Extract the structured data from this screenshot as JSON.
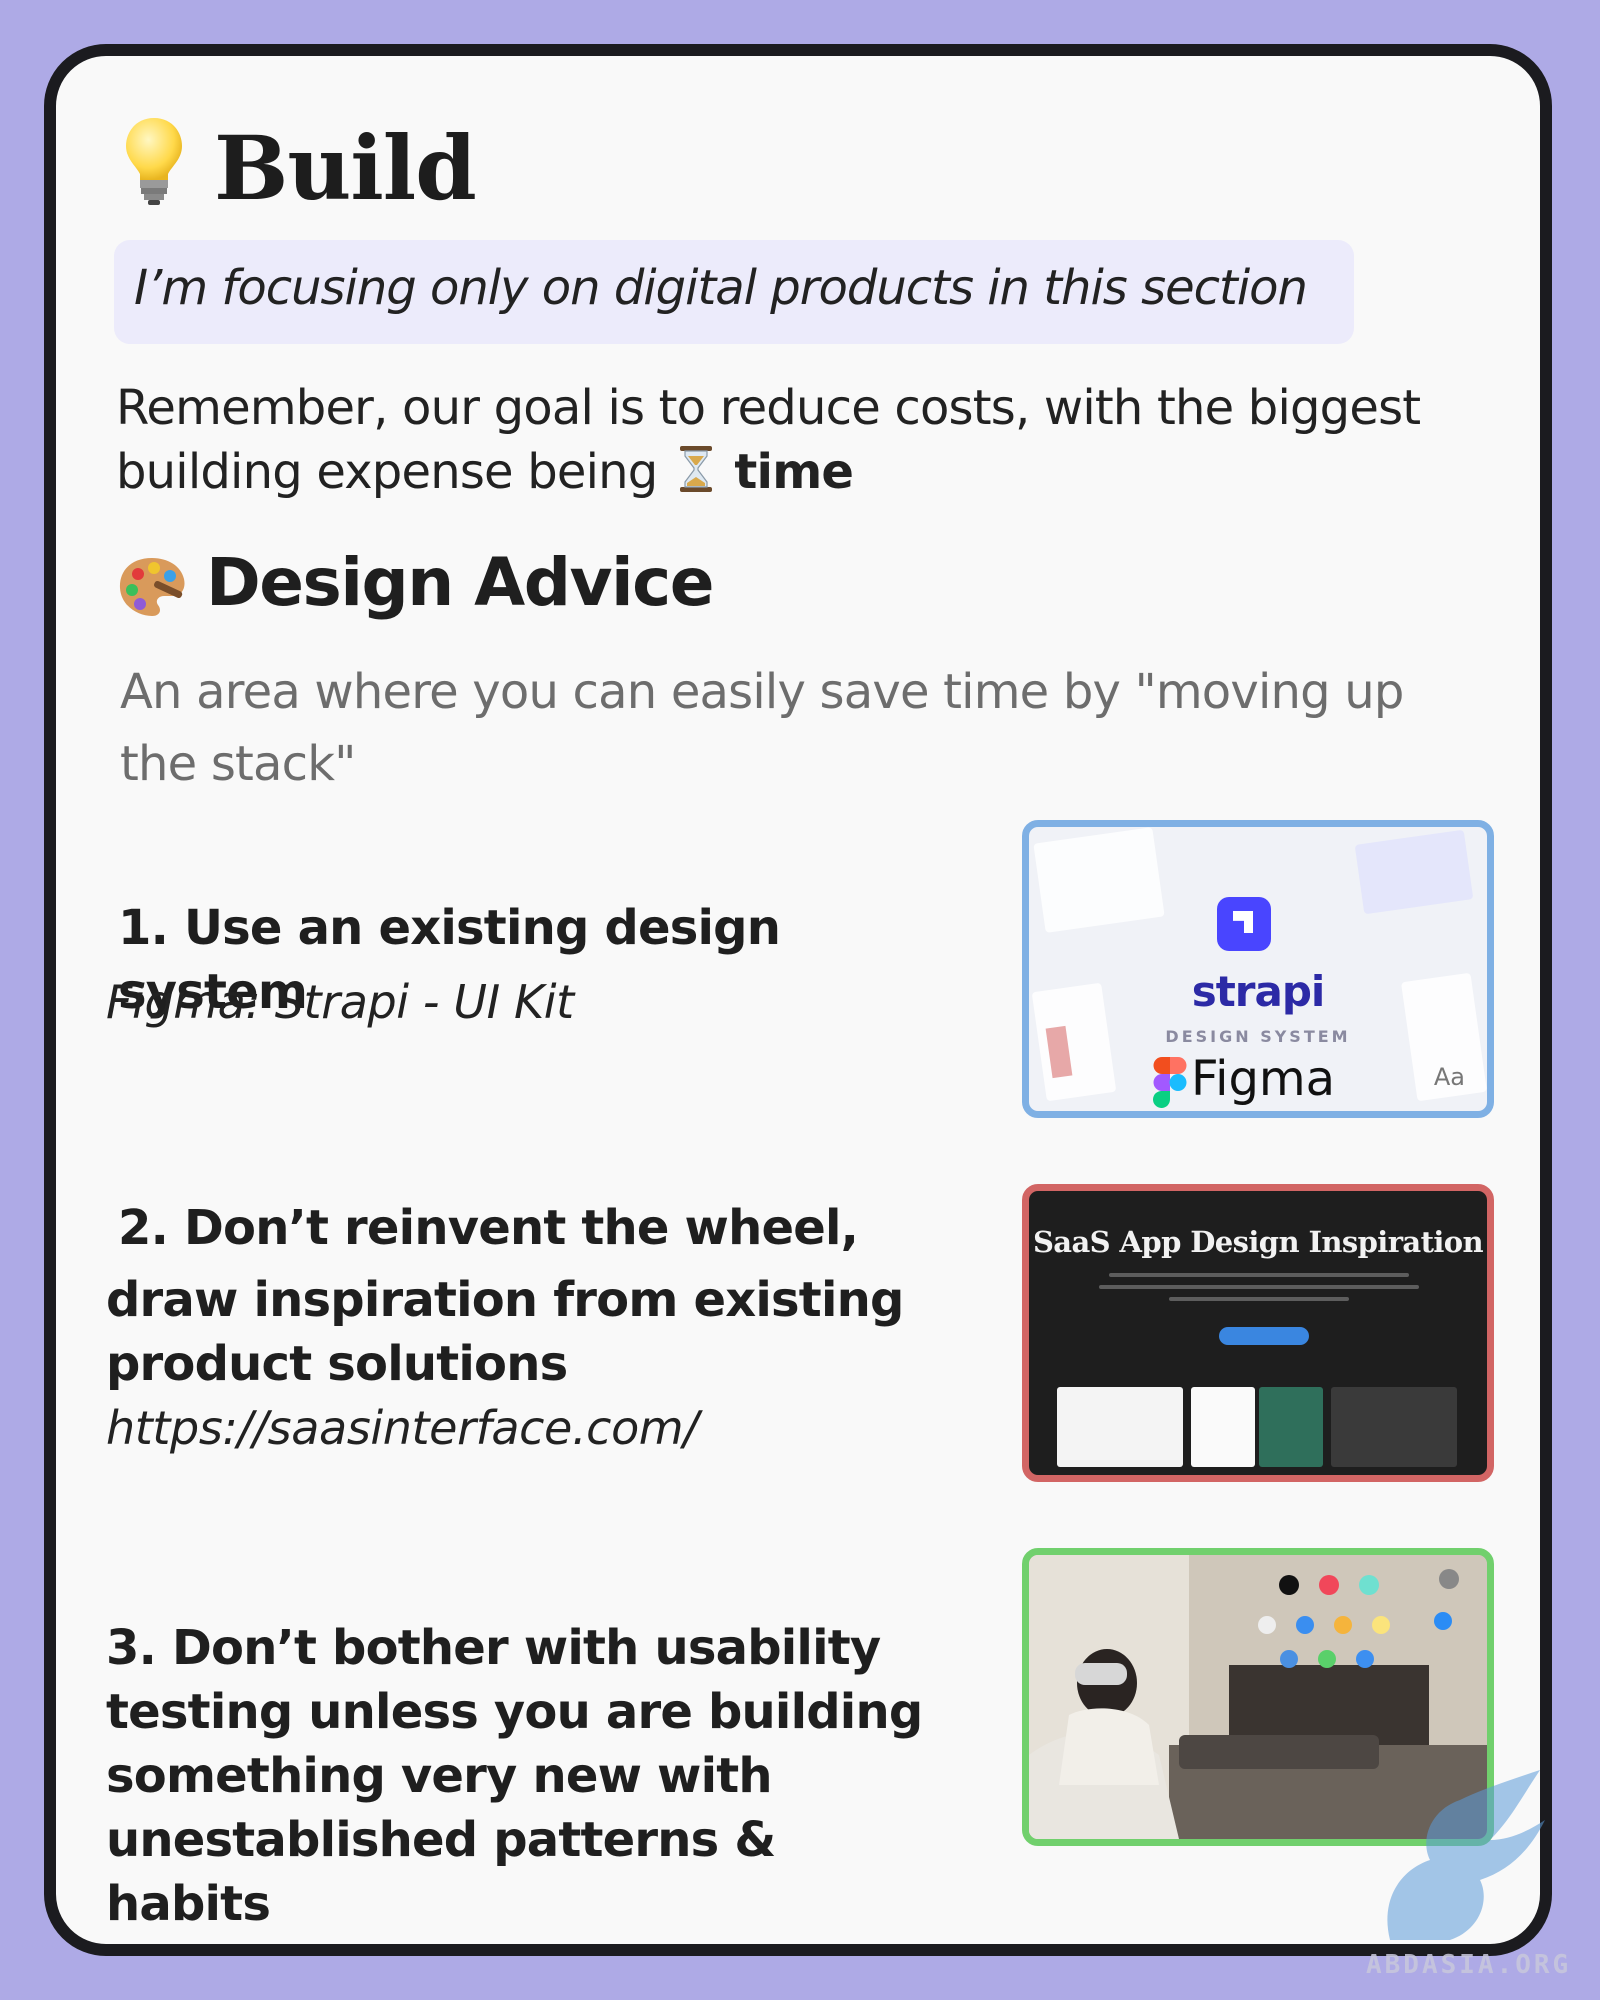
{
  "header": {
    "title": "Build",
    "icon": "lightbulb-icon"
  },
  "note": "I’m focusing only on digital products in this section",
  "intro": {
    "text_before": "Remember, our goal is to reduce costs, with the biggest building expense being",
    "emphasis": "time",
    "icon": "hourglass-icon"
  },
  "section": {
    "title": "Design Advice",
    "icon": "palette-icon",
    "subtitle": "An area where you can easily save time by \"moving up the stack\""
  },
  "items": [
    {
      "number": "1.",
      "head_line1": "Use an existing design system",
      "sub": "Figma: Strapi - UI Kit",
      "thumb": {
        "brand": "strapi",
        "caption": "DESIGN SYSTEM",
        "tool": "Figma",
        "corner": "Aa",
        "border_color": "#7fb0e4"
      }
    },
    {
      "number": "2.",
      "head_line1": "Don’t reinvent the wheel,",
      "head_rest": "draw inspiration from existing product solutions",
      "sub": "https://saasinterface.com/",
      "thumb": {
        "title": "SaaS App Design Inspiration",
        "border_color": "#d26564"
      }
    },
    {
      "number": "3.",
      "head_line1": "Don’t bother with usability testing unless you are building something very new with unestablished patterns  & habits",
      "thumb": {
        "border_color": "#71d06d"
      }
    }
  ],
  "watermark": "ABDASIA.ORG"
}
